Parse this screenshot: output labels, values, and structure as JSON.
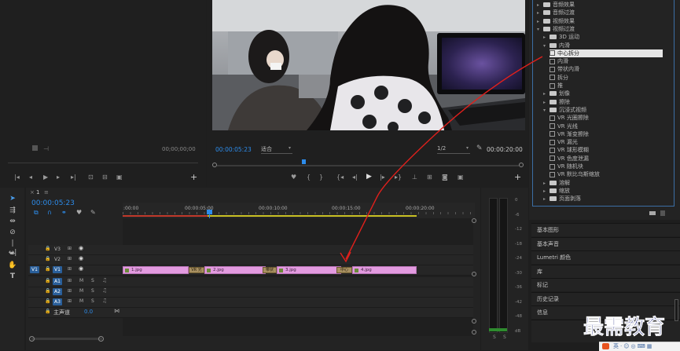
{
  "source_monitor": {
    "timecode": "00;00;00;00",
    "controls": [
      "◂",
      "◃",
      "▶",
      "▹",
      "▸"
    ],
    "add": "+"
  },
  "program_monitor": {
    "timecode": "00:00:05:23",
    "fit_label": "适合",
    "resolution": "1/2",
    "duration": "00:00:20:00",
    "add": "+"
  },
  "effects_panel": {
    "items": [
      {
        "label": "音频效果",
        "type": "folder",
        "indent": 0,
        "expanded": false
      },
      {
        "label": "音频过渡",
        "type": "folder",
        "indent": 0,
        "expanded": false
      },
      {
        "label": "视频效果",
        "type": "folder",
        "indent": 0,
        "expanded": false
      },
      {
        "label": "视频过渡",
        "type": "folder",
        "indent": 0,
        "expanded": true
      },
      {
        "label": "3D 运动",
        "type": "folder",
        "indent": 1,
        "expanded": false
      },
      {
        "label": "内滑",
        "type": "folder",
        "indent": 1,
        "expanded": true
      },
      {
        "label": "中心拆分",
        "type": "file",
        "indent": 2,
        "selected": true
      },
      {
        "label": "内滑",
        "type": "file",
        "indent": 2
      },
      {
        "label": "带状内滑",
        "type": "file",
        "indent": 2
      },
      {
        "label": "拆分",
        "type": "file",
        "indent": 2
      },
      {
        "label": "推",
        "type": "file",
        "indent": 2
      },
      {
        "label": "划像",
        "type": "folder",
        "indent": 1,
        "expanded": false
      },
      {
        "label": "擦除",
        "type": "folder",
        "indent": 1,
        "expanded": false
      },
      {
        "label": "沉浸式视频",
        "type": "folder",
        "indent": 1,
        "expanded": true
      },
      {
        "label": "VR 光圈擦除",
        "type": "file",
        "indent": 2
      },
      {
        "label": "VR 光线",
        "type": "file",
        "indent": 2
      },
      {
        "label": "VR 渐变擦除",
        "type": "file",
        "indent": 2
      },
      {
        "label": "VR 漏光",
        "type": "file",
        "indent": 2
      },
      {
        "label": "VR 球形模糊",
        "type": "file",
        "indent": 2
      },
      {
        "label": "VR 色度泄漏",
        "type": "file",
        "indent": 2
      },
      {
        "label": "VR 随机块",
        "type": "file",
        "indent": 2
      },
      {
        "label": "VR 默比乌斯缩放",
        "type": "file",
        "indent": 2
      },
      {
        "label": "溶解",
        "type": "folder",
        "indent": 1,
        "expanded": false
      },
      {
        "label": "缩放",
        "type": "folder",
        "indent": 1,
        "expanded": false
      },
      {
        "label": "页面剥落",
        "type": "folder",
        "indent": 1,
        "expanded": false
      }
    ]
  },
  "lower_panels": [
    "基本图形",
    "基本声音",
    "Lumetri 颜色",
    "库",
    "标记",
    "历史记录",
    "信息"
  ],
  "timeline": {
    "tab": "1",
    "timecode": "00:00:05:23",
    "ruler": [
      ":00:00",
      "00:00:05:00",
      "00:00:10:00",
      "00:00:15:00",
      "00:00:20:00"
    ],
    "video_tracks": [
      "V3",
      "V2",
      "V1"
    ],
    "audio_tracks": [
      "A1",
      "A2",
      "A3"
    ],
    "source_patch_video": "V1",
    "master_track": "主声道",
    "master_value": "0.0",
    "clips": [
      "1.jpg",
      "2.jpg",
      "3.jpg",
      "4.jpg"
    ],
    "transitions": [
      "VR 光",
      "带状",
      "中心"
    ],
    "mute_label": "M",
    "solo_label": "S"
  },
  "meter": {
    "scale": [
      "0",
      "-6",
      "-12",
      "-18",
      "-24",
      "-30",
      "-36",
      "-42",
      "-48",
      "dB"
    ],
    "bottom": [
      "S",
      "S"
    ]
  },
  "watermark": {
    "text": "最需教育"
  },
  "colors": {
    "accent": "#2d8ceb",
    "clip": "#e39be0",
    "annotation": "#e0201c",
    "watermark": "#1a237e"
  }
}
